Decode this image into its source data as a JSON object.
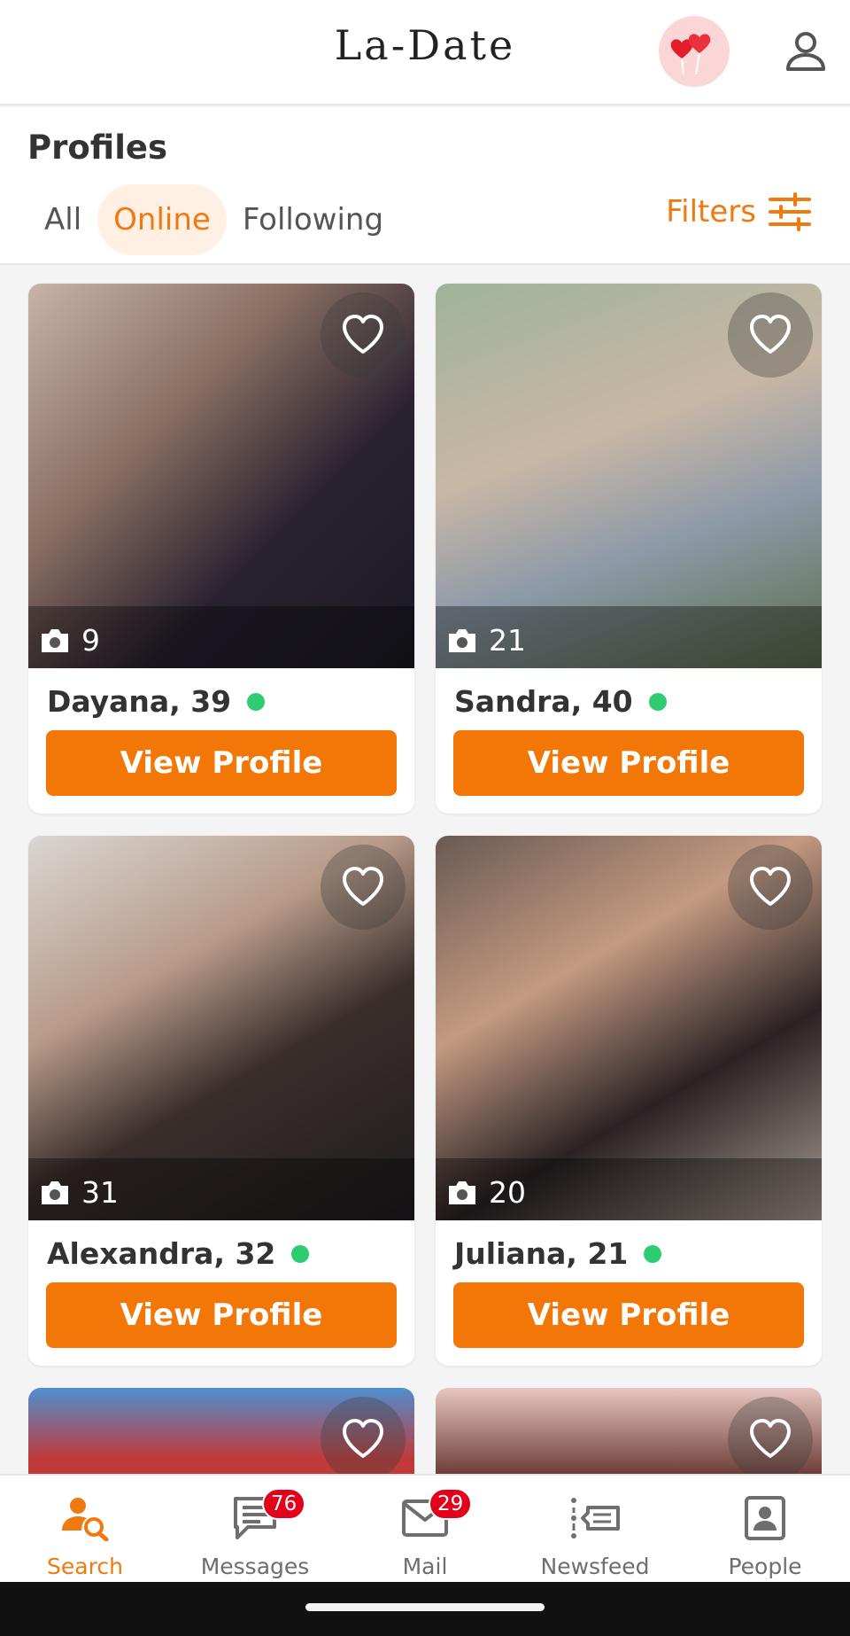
{
  "app": {
    "brand": "La-Date"
  },
  "section": {
    "title": "Profiles",
    "tabs": [
      {
        "label": "All",
        "active": false
      },
      {
        "label": "Online",
        "active": true
      },
      {
        "label": "Following",
        "active": false
      }
    ],
    "filters_label": "Filters"
  },
  "profiles": [
    {
      "name": "Dayana, 39",
      "photos": "9",
      "online": true,
      "button": "View Profile"
    },
    {
      "name": "Sandra, 40",
      "photos": "21",
      "online": true,
      "button": "View Profile"
    },
    {
      "name": "Alexandra, 32",
      "photos": "31",
      "online": true,
      "button": "View Profile"
    },
    {
      "name": "Juliana, 21",
      "photos": "20",
      "online": true,
      "button": "View Profile"
    }
  ],
  "bottom_nav": [
    {
      "label": "Search",
      "icon": "search-people-icon",
      "active": true,
      "badge": ""
    },
    {
      "label": "Messages",
      "icon": "chat-icon",
      "active": false,
      "badge": "76"
    },
    {
      "label": "Mail",
      "icon": "mail-icon",
      "active": false,
      "badge": "29"
    },
    {
      "label": "Newsfeed",
      "icon": "newsfeed-icon",
      "active": false,
      "badge": ""
    },
    {
      "label": "People",
      "icon": "contact-card-icon",
      "active": false,
      "badge": ""
    }
  ],
  "colors": {
    "accent": "#f27707",
    "online": "#2ecc71",
    "badge": "#e3001b"
  }
}
